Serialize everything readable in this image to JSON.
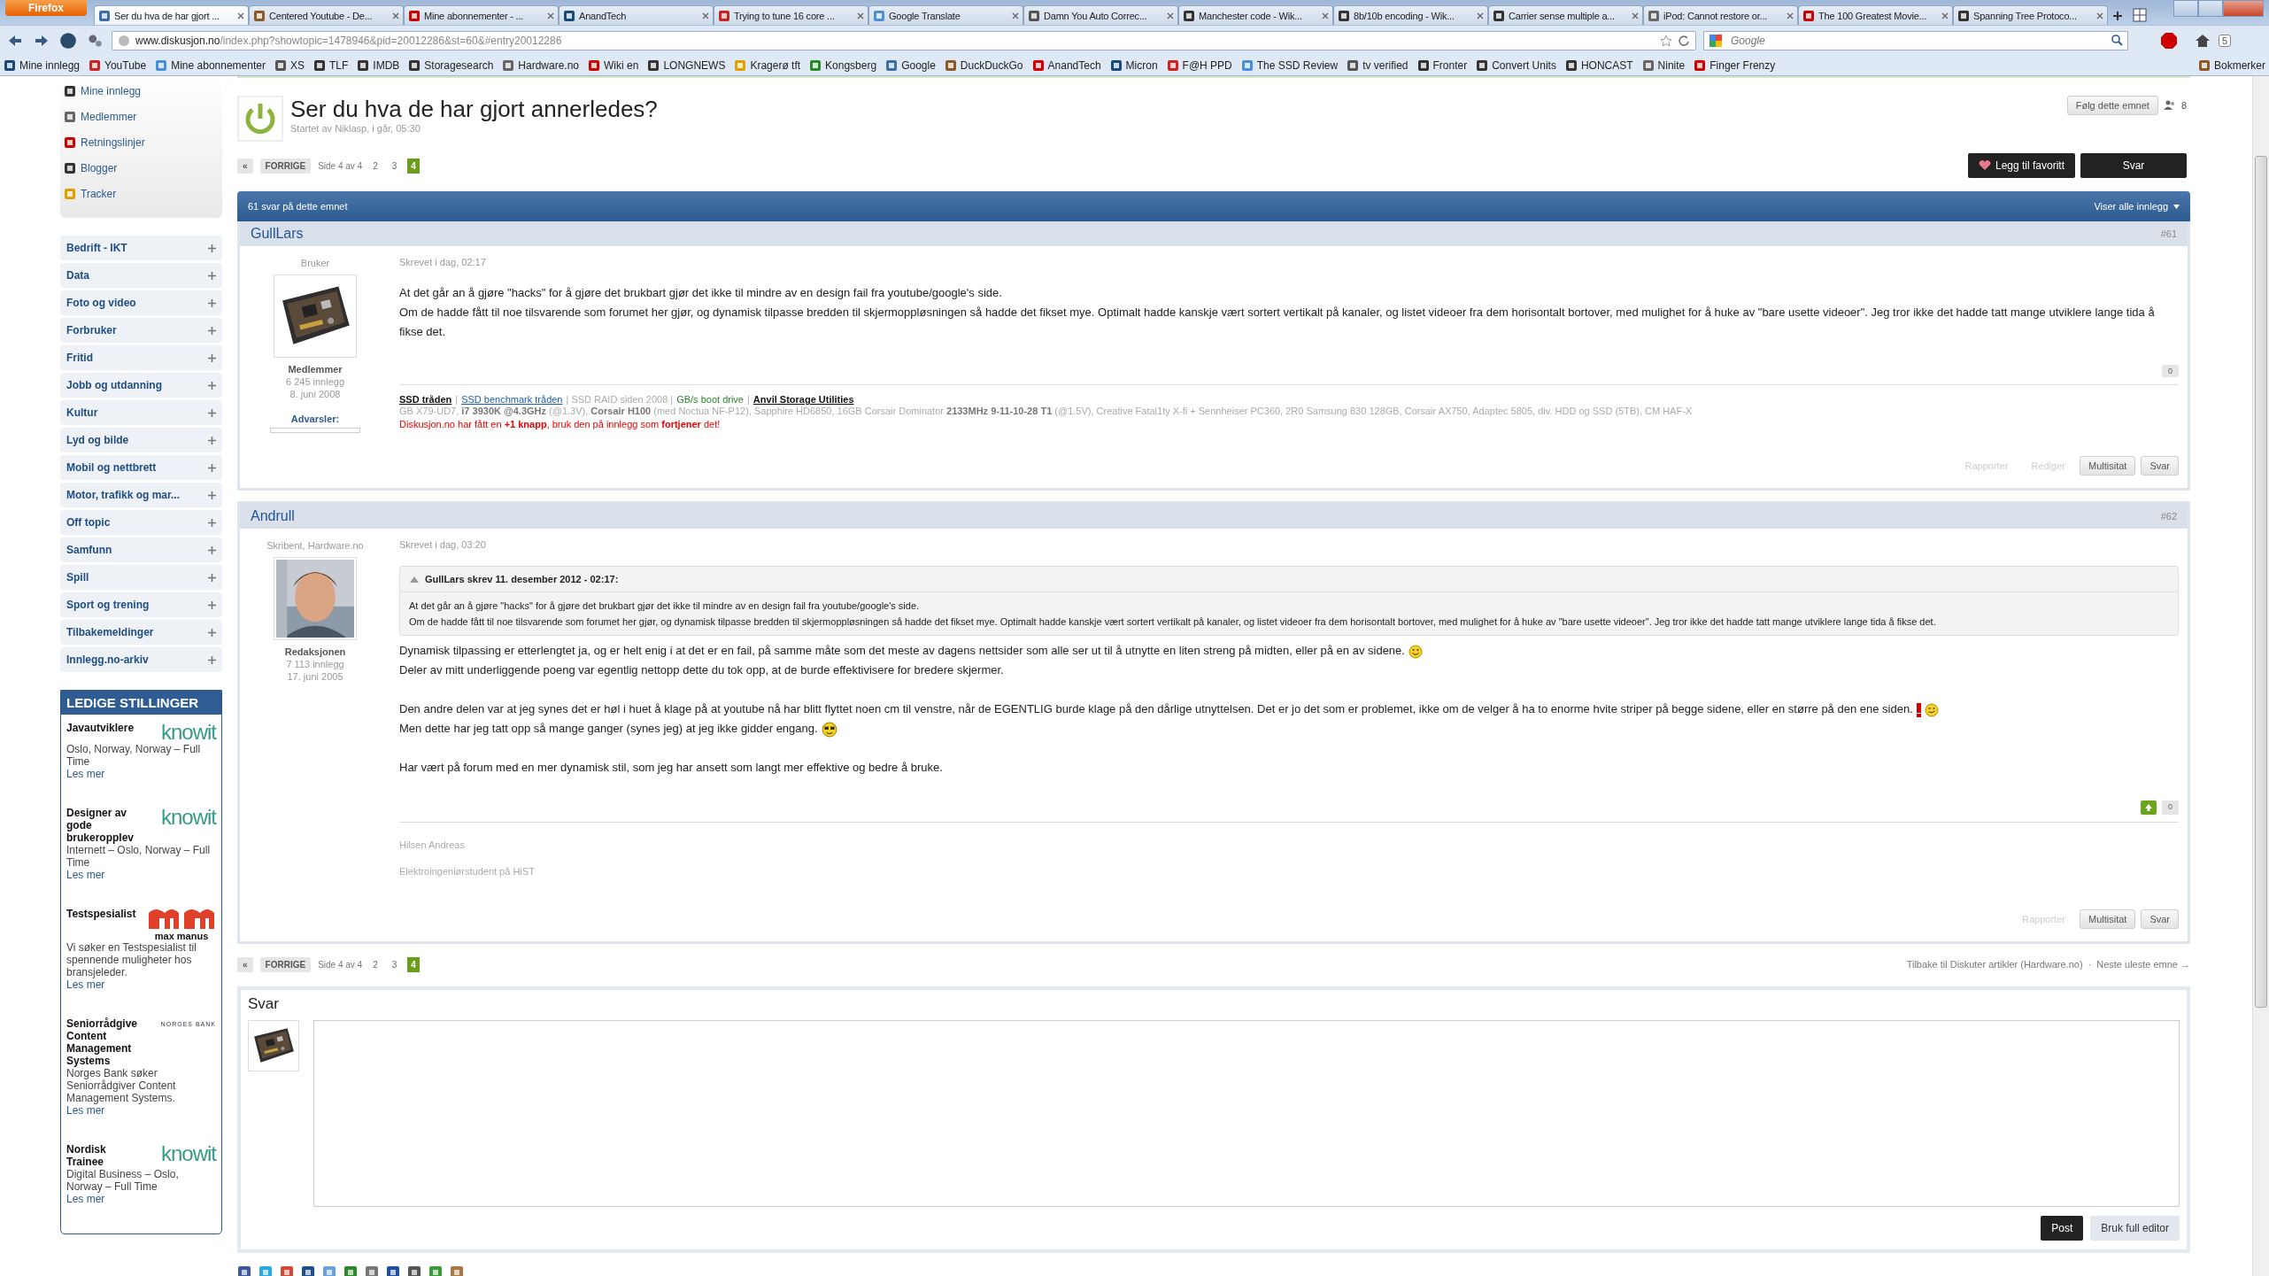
{
  "browser": {
    "menu_button": "Firefox",
    "tabs": [
      {
        "title": "Ser du hva de har gjort ...",
        "selected": true
      },
      {
        "title": "Centered Youtube - De...",
        "selected": false
      },
      {
        "title": "Mine abonnementer - ...",
        "selected": false
      },
      {
        "title": "AnandTech",
        "selected": false
      },
      {
        "title": "Trying to tune 16 core ...",
        "selected": false
      },
      {
        "title": "Google Translate",
        "selected": false
      },
      {
        "title": "Damn You Auto Correc...",
        "selected": false
      },
      {
        "title": "Manchester code - Wik...",
        "selected": false
      },
      {
        "title": "8b/10b encoding - Wik...",
        "selected": false
      },
      {
        "title": "Carrier sense multiple a...",
        "selected": false
      },
      {
        "title": "iPod: Cannot restore or...",
        "selected": false
      },
      {
        "title": "The 100 Greatest Movie...",
        "selected": false
      },
      {
        "title": "Spanning Tree Protoco...",
        "selected": false
      }
    ],
    "url_host": "www.diskusjon.no",
    "url_path": "/index.php?showtopic=1478946&pid=20012286&st=60&#entry20012286",
    "search_placeholder": "Google",
    "badge": "5",
    "bookmarks": [
      "Mine innlegg",
      "YouTube",
      "Mine abonnementer",
      "XS",
      "TLF",
      "IMDB",
      "Storagesearch",
      "Hardware.no",
      "Wiki en",
      "LONGNEWS",
      "Kragerø tft",
      "Kongsberg",
      "Google",
      "DuckDuckGo",
      "AnandTech",
      "Micron",
      "F@H PPD",
      "The SSD Review",
      "tv verified",
      "Fronter",
      "Convert Units",
      "HONCAST",
      "Ninite",
      "Finger Frenzy"
    ],
    "bookmarks_folder": "Bokmerker"
  },
  "sidebar": {
    "links": [
      "Mine innlegg",
      "Medlemmer",
      "Retningslinjer",
      "Blogger",
      "Tracker"
    ],
    "categories": [
      "Bedrift - IKT",
      "Data",
      "Foto og video",
      "Forbruker",
      "Fritid",
      "Jobb og utdanning",
      "Kultur",
      "Lyd og bilde",
      "Mobil og nettbrett",
      "Motor, trafikk og mar...",
      "Off topic",
      "Samfunn",
      "Spill",
      "Sport og trening",
      "Tilbakemeldinger",
      "Innlegg.no-arkiv"
    ],
    "jobs_title": "LEDIGE STILLINGER",
    "jobs": [
      {
        "title": "Javautviklere",
        "logo": {
          "kind": "knowit",
          "text": "knowit"
        },
        "description": "Oslo, Norway, Norway – Full Time",
        "more": "Les mer"
      },
      {
        "title": "Designer av gode brukeropplev",
        "logo": {
          "kind": "knowit",
          "text": "knowit"
        },
        "description": "Internett – Oslo, Norway – Full Time",
        "more": "Les mer"
      },
      {
        "title": "Testspesialist",
        "logo": {
          "kind": "maxmanus",
          "text": "max manus"
        },
        "description": "Vi søker en Testspesialist til spennende muligheter hos bransjeleder.",
        "more": "Les mer"
      },
      {
        "title": "Seniorrådgive Content Management Systems",
        "logo": {
          "kind": "norgesbank",
          "text": "NORGES BANK"
        },
        "description": "Norges Bank søker Seniorrådgiver Content Management Systems.",
        "more": "Les mer"
      },
      {
        "title": "Nordisk Trainee",
        "logo": {
          "kind": "knowit",
          "text": "knowit"
        },
        "description": "Digital Business – Oslo, Norway – Full Time",
        "more": "Les mer"
      }
    ]
  },
  "topic": {
    "title": "Ser du hva de har gjort annerledes?",
    "meta": "Startet av Niklasp, i går, 05:30",
    "follow": "Følg dette emnet",
    "followers": "8",
    "favorite": "Legg til favoritt",
    "reply": "Svar"
  },
  "pagination_top": {
    "first": "«",
    "prev": "FORRIGE",
    "info": "Side 4 av 4",
    "pages": [
      {
        "label": "2",
        "selected": false
      },
      {
        "label": "3",
        "selected": false
      },
      {
        "label": "4",
        "selected": true
      }
    ]
  },
  "bar": {
    "count": "61 svar på dette emnet",
    "filter": "Viser alle innlegg"
  },
  "posts": [
    {
      "author": "GullLars",
      "number": "#61",
      "role": "Bruker",
      "group": "Medlemmer",
      "post_count": "6 245 innlegg",
      "joined": "8. juni 2008",
      "warnings": "Advarsler:",
      "date": "Skrevet i dag, 02:17",
      "paragraphs": [
        [
          {
            "text": "At det går an å gjøre \"hacks\" for å gjøre det brukbart gjør det ikke til mindre av en design fail fra youtube/google's side."
          },
          {
            "text": "Om de hadde fått til noe tilsvarende som forumet her gjør, og dynamisk tilpasse bredden til skjermoppløsningen så hadde det fikset mye. Optimalt hadde kanskje vært sortert vertikalt på kanaler, og listet videoer fra dem horisontalt bortover, med mulighet for å huke av \"bare usette videoer\". Jeg tror ikke det hadde tatt mange utviklere lange tida å fikse det."
          }
        ]
      ],
      "vote_up": false,
      "reputation": "0",
      "signature_links": [
        {
          "text": "SSD tråden",
          "kind": "strong-link"
        },
        {
          "text": "|",
          "kind": "sep"
        },
        {
          "text": "SSD benchmark tråden",
          "kind": "link"
        },
        {
          "text": "| SSD RAID siden 2008 |",
          "kind": "muted"
        },
        {
          "text": "GB/s boot drive",
          "kind": "green"
        },
        {
          "text": "|",
          "kind": "sep"
        },
        {
          "text": "Anvil Storage Utilities",
          "kind": "strong-link"
        }
      ],
      "signature_lines": [
        {
          "text": "GB X79-UD7, **i7 3930K @4.3GHz** (@1.3V), **Corsair H100** (med Noctua NF-P12), Sapphire HD6850, 16GB Corsair Dominator **2133MHz 9-11-10-28 T1** (@1.5V), Creative Fatal1ty X-fi + Sennheiser PC360, 2R0 Samsung 830 128GB, Corsair AX750, Adaptec 5805, div. HDD og SSD (5TB), CM HAF-X",
          "kind": "muted"
        },
        {
          "text": "Diskusjon.no har fått en **+1 knapp**, bruk den på innlegg som **fortjener** det!",
          "kind": "alert"
        }
      ],
      "buttons": [
        {
          "label": "Rapporter",
          "disabled": true
        },
        {
          "label": "Rediger",
          "disabled": true
        },
        {
          "label": "Multisitat",
          "disabled": false
        },
        {
          "label": "Svar",
          "disabled": false
        }
      ]
    },
    {
      "author": "Andrull",
      "number": "#62",
      "role": "Skribent, Hardware.no",
      "group": "Redaksjonen",
      "post_count": "7 113 innlegg",
      "joined": "17. juni 2005",
      "date": "Skrevet i dag, 03:20",
      "quote": {
        "header": "GullLars skrev 11. desember 2012 - 02:17:",
        "lines": [
          "At det går an å gjøre \"hacks\" for å gjøre det brukbart gjør det ikke til mindre av en design fail fra youtube/google's side.",
          "Om de hadde fått til noe tilsvarende som forumet her gjør, og dynamisk tilpasse bredden til skjermoppløsningen så hadde det fikset mye. Optimalt hadde kanskje vært sortert vertikalt på kanaler, og listet videoer fra dem horisontalt bortover, med mulighet for å huke av \"bare usette videoer\". Jeg tror ikke det hadde tatt mange utviklere lange tida å fikse det."
        ]
      },
      "paragraphs": [
        [
          {
            "text": "Dynamisk tilpassing er etterlengtet ja, og er helt enig i at det er en fail, på samme måte som det meste av dagens nettsider som alle ser ut til å utnytte en liten streng på midten, eller på en av sidene.",
            "emoticons": [
              {
                "kind": "smile"
              }
            ]
          },
          {
            "text": "Deler av mitt underliggende poeng var egentlig nettopp dette du tok opp, at de burde effektivisere for bredere skjermer."
          }
        ],
        [
          {
            "text": "Den andre delen var at jeg synes det er høl i huet å klage på at youtube nå har blitt flyttet noen cm til venstre, når de EGENTLIG burde klage på den dårlige utnyttelsen. Det er jo det som er problemet, ikke om de velger å ha to enorme hvite striper på begge sidene, eller en større på den ene siden.",
            "emoticons": [
              {
                "kind": "exclaim"
              },
              {
                "kind": "wink"
              }
            ]
          },
          {
            "text": "Men dette har jeg tatt opp så mange ganger (synes jeg) at jeg ikke gidder engang.",
            "emoticons": [
              {
                "kind": "cool"
              }
            ]
          }
        ],
        [
          {
            "text": "Har vært på forum med en mer dynamisk stil, som jeg har ansett som langt mer effektive og bedre å bruke."
          }
        ]
      ],
      "vote_up": true,
      "reputation": "0",
      "signature_lines": [
        {
          "text": "Hilsen Andreas",
          "kind": "muted"
        },
        {
          "text": "Elektroingeniørstudent på HiST",
          "kind": "muted"
        }
      ],
      "buttons": [
        {
          "label": "Rapporter",
          "disabled": true
        },
        {
          "label": "Multisitat",
          "disabled": false
        },
        {
          "label": "Svar",
          "disabled": false
        }
      ]
    }
  ],
  "pagination_bottom": {
    "first": "«",
    "prev": "FORRIGE",
    "info": "Side 4 av 4",
    "pages": [
      {
        "label": "2",
        "selected": false
      },
      {
        "label": "3",
        "selected": false
      },
      {
        "label": "4",
        "selected": true
      }
    ],
    "back_link": "Tilbake til Diskuter artikler (Hardware.no)",
    "separator": "·",
    "next_link": "Neste uleste emne →"
  },
  "reply": {
    "title": "Svar",
    "submit": "Post",
    "full_editor": "Bruk full editor"
  }
}
